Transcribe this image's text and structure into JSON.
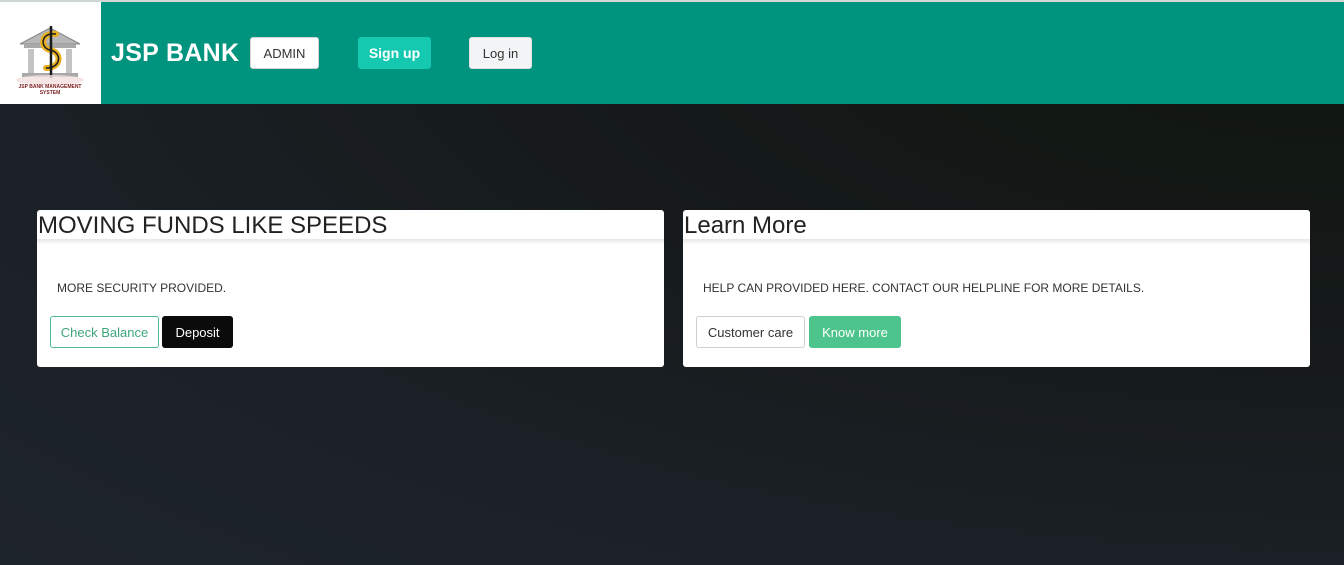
{
  "header": {
    "logo_caption": "JSP BANK MANAGEMENT SYSTEM",
    "brand": "JSP BANK",
    "admin_label": "ADMIN",
    "signup_label": "Sign up",
    "login_label": "Log in"
  },
  "cards": [
    {
      "title": "MOVING FUNDS LIKE SPEEDS",
      "text": "MORE SECURITY PROVIDED.",
      "buttons": [
        "Check Balance",
        "Deposit"
      ]
    },
    {
      "title": "Learn More",
      "text": "HELP CAN PROVIDED HERE. CONTACT OUR HELPLINE FOR MORE DETAILS.",
      "buttons": [
        "Customer care",
        "Know more"
      ]
    }
  ],
  "colors": {
    "navbar": "#00937d",
    "signup": "#14c9b0",
    "check_balance": "#4dbb8e",
    "know_more": "#4cc48c",
    "background": "#15191a"
  },
  "icons": {
    "logo": "bank-building-rupee-logo"
  }
}
